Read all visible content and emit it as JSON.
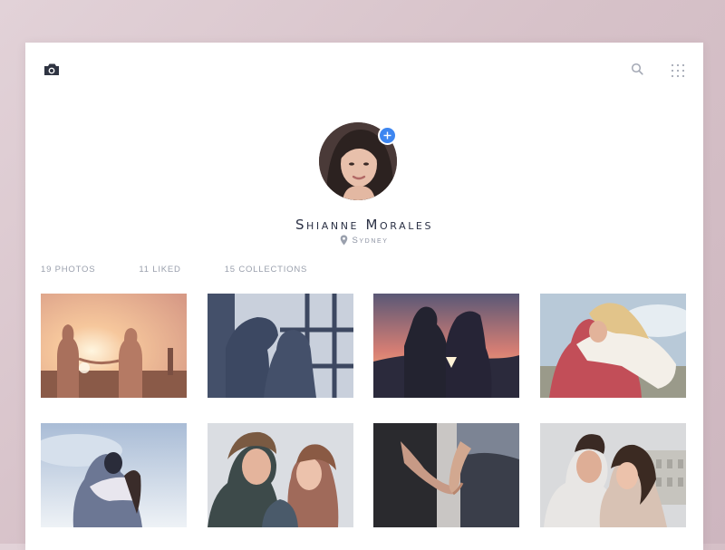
{
  "profile": {
    "name": "Shianne Morales",
    "location": "Sydney"
  },
  "stats": {
    "photos": "19 PHOTOS",
    "liked": "11 LIKED",
    "collections": "15 COLLECTIONS"
  },
  "icons": {
    "camera": "camera-icon",
    "search": "search-icon",
    "grid": "grid-menu-icon",
    "add": "plus-icon",
    "location": "location-pin-icon"
  },
  "colors": {
    "accent": "#3d86f0",
    "name_text": "#2b3145",
    "muted_text": "#9aa0ad",
    "background": "#d9c6cd"
  },
  "photos": [
    {
      "subject": "couple-holding-hands-sunset"
    },
    {
      "subject": "couple-silhouette-window"
    },
    {
      "subject": "couple-silhouette-sunset-kiss"
    },
    {
      "subject": "couple-embrace-beach"
    },
    {
      "subject": "couple-hug-sky"
    },
    {
      "subject": "couple-nose-touch"
    },
    {
      "subject": "holding-hands-closeup"
    },
    {
      "subject": "couple-portrait-city"
    }
  ]
}
